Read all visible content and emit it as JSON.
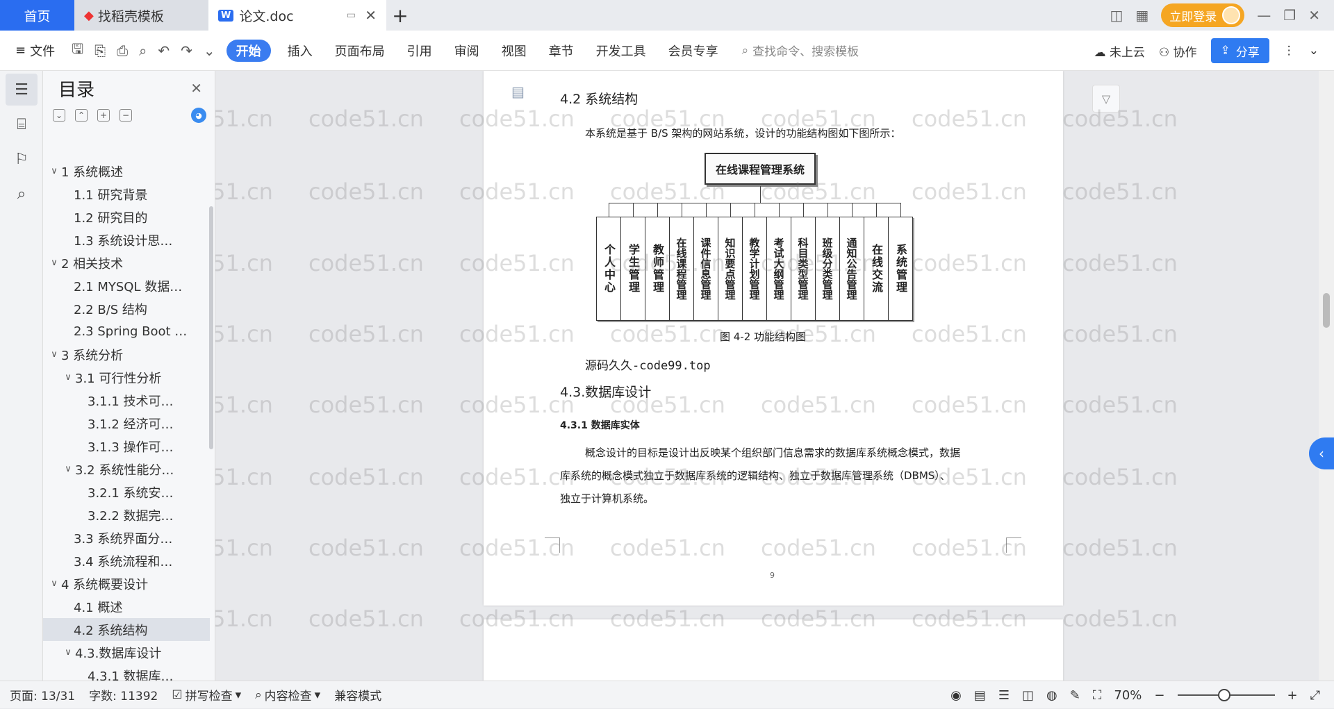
{
  "tabs": {
    "home": "首页",
    "template": "找稻壳模板",
    "doc": "论文.doc"
  },
  "titlebar": {
    "login": "立即登录"
  },
  "ribbon": {
    "file": "文件",
    "items": [
      "开始",
      "插入",
      "页面布局",
      "引用",
      "审阅",
      "视图",
      "章节",
      "开发工具",
      "会员专享"
    ],
    "search": "查找命令、搜索模板",
    "cloud": "未上云",
    "collab": "协作",
    "share": "分享"
  },
  "toc": {
    "title": "目录",
    "items": [
      {
        "text": "1 系统概述",
        "level": 1,
        "chev": "∨"
      },
      {
        "text": "1.1  研究背景",
        "level": 2,
        "chev": ""
      },
      {
        "text": "1.2 研究目的",
        "level": 2,
        "chev": ""
      },
      {
        "text": "1.3 系统设计思…",
        "level": 2,
        "chev": ""
      },
      {
        "text": "2 相关技术",
        "level": 1,
        "chev": "∨"
      },
      {
        "text": "2.1 MYSQL 数据…",
        "level": 2,
        "chev": ""
      },
      {
        "text": "2.2 B/S 结构",
        "level": 2,
        "chev": ""
      },
      {
        "text": "2.3 Spring Boot …",
        "level": 2,
        "chev": ""
      },
      {
        "text": "3 系统分析",
        "level": 1,
        "chev": "∨"
      },
      {
        "text": "3.1 可行性分析",
        "level": 2,
        "chev": "∨"
      },
      {
        "text": "3.1.1 技术可…",
        "level": 3,
        "chev": ""
      },
      {
        "text": "3.1.2 经济可…",
        "level": 3,
        "chev": ""
      },
      {
        "text": "3.1.3 操作可…",
        "level": 3,
        "chev": ""
      },
      {
        "text": "3.2 系统性能分…",
        "level": 2,
        "chev": "∨"
      },
      {
        "text": "3.2.1  系统安…",
        "level": 3,
        "chev": ""
      },
      {
        "text": "3.2.2  数据完…",
        "level": 3,
        "chev": ""
      },
      {
        "text": "3.3 系统界面分…",
        "level": 2,
        "chev": ""
      },
      {
        "text": "3.4 系统流程和…",
        "level": 2,
        "chev": ""
      },
      {
        "text": "4 系统概要设计",
        "level": 1,
        "chev": "∨"
      },
      {
        "text": "4.1 概述",
        "level": 2,
        "chev": ""
      },
      {
        "text": "4.2 系统结构",
        "level": 2,
        "chev": "",
        "selected": true
      },
      {
        "text": "4.3.数据库设计",
        "level": 2,
        "chev": "∨"
      },
      {
        "text": "4.3.1 数据库…",
        "level": 3,
        "chev": ""
      }
    ]
  },
  "doc": {
    "h2": "4.2 系统结构",
    "intro": "本系统是基于 B/S 架构的网站系统，设计的功能结构图如下图所示：",
    "root": "在线课程管理系统",
    "leaves": [
      "个人中心",
      "学生管理",
      "教师管理",
      "在线课程管理",
      "课件信息管理",
      "知识要点管理",
      "教学计划管理",
      "考试大纲管理",
      "科目类型管理",
      "班级分类管理",
      "通知公告管理",
      "在线交流",
      "系统管理"
    ],
    "caption": "图 4-2 功能结构图",
    "source": "源码久久-code99.top",
    "h3": "4.3.数据库设计",
    "h4": "4.3.1 数据库实体",
    "p1": "概念设计的目标是设计出反映某个组织部门信息需求的数据库系统概念模式，数据",
    "p2": "库系统的概念模式独立于数据库系统的逻辑结构、独立于数据库管理系统（DBMS）、",
    "p3": "独立于计算机系统。",
    "page_num": "9"
  },
  "watermark": "code51.cn",
  "status": {
    "page": "页面: 13/31",
    "words": "字数: 11392",
    "spell": "拼写检查",
    "content": "内容检查",
    "compat": "兼容模式",
    "zoom": "70%"
  }
}
